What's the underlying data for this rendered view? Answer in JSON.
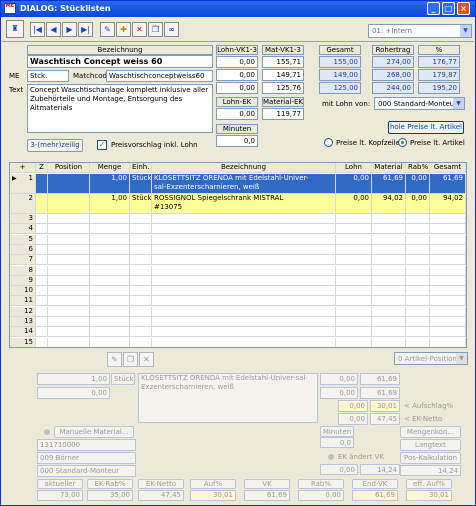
{
  "window": {
    "title": "DIALOG: Stücklisten",
    "app_badge": "ME"
  },
  "toolbar": {
    "combo_value": "01: +Intern"
  },
  "article": {
    "bez_header": "Bezeichnung",
    "bezeichnung": "Waschtisch Concept weiss 60",
    "me_label": "ME",
    "me_value": "Stck.",
    "matchcode_label": "Matchcode",
    "matchcode_value": "Waschtischconceptweiss60",
    "text_label": "Text",
    "text_value": "Concept Waschtischanlage komplett inklusive aller Zubehörteile und Montage, Entsorgung des Altmaterials",
    "mehrzeilig_label": "3-(mehr)zeilig",
    "preisvorschlag_label": "Preisvorschlag inkl. Lohn"
  },
  "prices": {
    "lohn_vk_header": "Lohn-VK1-3",
    "lohn_vk": [
      "0,00",
      "0,00",
      "0,00"
    ],
    "mat_vk_header": "Mat-VK1-3",
    "mat_vk": [
      "155,71",
      "149,71",
      "125,76"
    ],
    "lohn_ek_header": "Lohn-EK",
    "lohn_ek": "0,00",
    "material_ek_header": "Material-EK",
    "material_ek": "119,77",
    "minuten_header": "Minuten",
    "minuten": "0,0",
    "gesamt_header": "Gesamt",
    "gesamt": [
      "155,00",
      "149,00",
      "125,00"
    ],
    "rohertrag_header": "Rohertrag",
    "rohertrag": [
      "274,00",
      "268,00",
      "244,00"
    ],
    "pct_header": "%",
    "pct": [
      "176,77",
      "179,87",
      "195,20"
    ],
    "mit_lohn_label": "mit Lohn von:",
    "mit_lohn_value": "000 Standard-Monteur",
    "hole_preise_label": "hole Preise lt. Artikel",
    "radio_kopfzeile": "Preise lt. Kopfzeile",
    "radio_artikel": "Preise lt. Artikel"
  },
  "grid": {
    "headers": [
      "Z",
      "Position",
      "Menge",
      "Einh.",
      "Bezeichnung",
      "Lohn",
      "Material",
      "Rab%",
      "Gesamt"
    ],
    "rows": [
      {
        "nr": "1",
        "z": "",
        "position": "",
        "menge": "1,00",
        "einh": "Stück",
        "bez1": "KLOSETTSITZ ORENDA mit Edelstahl-Univer-",
        "bez2": "sal-Exzenterscharnieren, weiß",
        "lohn": "0,00",
        "material": "61,69",
        "rab": "0,00",
        "gesamt": "61,69"
      },
      {
        "nr": "2",
        "z": "",
        "position": "",
        "menge": "1,00",
        "einh": "Stück",
        "bez1": "ROSSIGNOL Spiegelschrank MISTRAL",
        "bez2": "#13075",
        "lohn": "0,00",
        "material": "94,02",
        "rab": "0,00",
        "gesamt": "94,02"
      }
    ],
    "empty_rows": [
      "3",
      "4",
      "5",
      "6",
      "7",
      "8",
      "9",
      "10",
      "11",
      "12",
      "13",
      "14",
      "15"
    ]
  },
  "lower": {
    "position_combo": "0  Artikel-Position",
    "menge": "1,00",
    "einh": "Stück",
    "menge2": "0,00",
    "bezeichnung": "KLOSETTSITZ ORENDA mit Edelstahl-Univer-sal-Exzenterscharnieren, weiß",
    "lohn1": "0,00",
    "material1": "61,69",
    "lohn2": "0,00",
    "material2": "61,69",
    "aufschlag_label": "Aufschlag%",
    "aufschlag_a": "0,00",
    "aufschlag_b": "30,01",
    "ek_netto_label": "EK-Netto",
    "ek_netto_a": "0,00",
    "ek_netto_b": "47,45",
    "manuelle_label": "Manuelle Material...",
    "art_nr": "131710000",
    "lieferant": "009 Börner",
    "monteur": "000 Standard-Monteur",
    "minuten_label": "Minuten",
    "minuten_value": "0,0",
    "ek_aendert_label": "EK ändert VK",
    "ek_aendert_a": "0,00",
    "ek_aendert_b": "14,24",
    "mengenkon_label": "Mengenkon...",
    "langtext_label": "Langtext",
    "kalkulation_label": "Pos-Kalkulation",
    "kalk_value": "14,24",
    "footer_labels": [
      "aktueller",
      "EK-Rab%",
      "EK-Netto",
      "Auf%",
      "VK",
      "Rab%",
      "End-VK",
      "eff. Auf%"
    ],
    "footer_values": [
      "73,00",
      "35,00",
      "47,45",
      "30,01",
      "61,69",
      "0,00",
      "61,69",
      "30,01"
    ]
  },
  "colors": {
    "title_bar": "#0a46d6",
    "selected_row": "#316ac5",
    "highlight_row": "#ffff99",
    "header_fill": "#dfe8f6"
  }
}
